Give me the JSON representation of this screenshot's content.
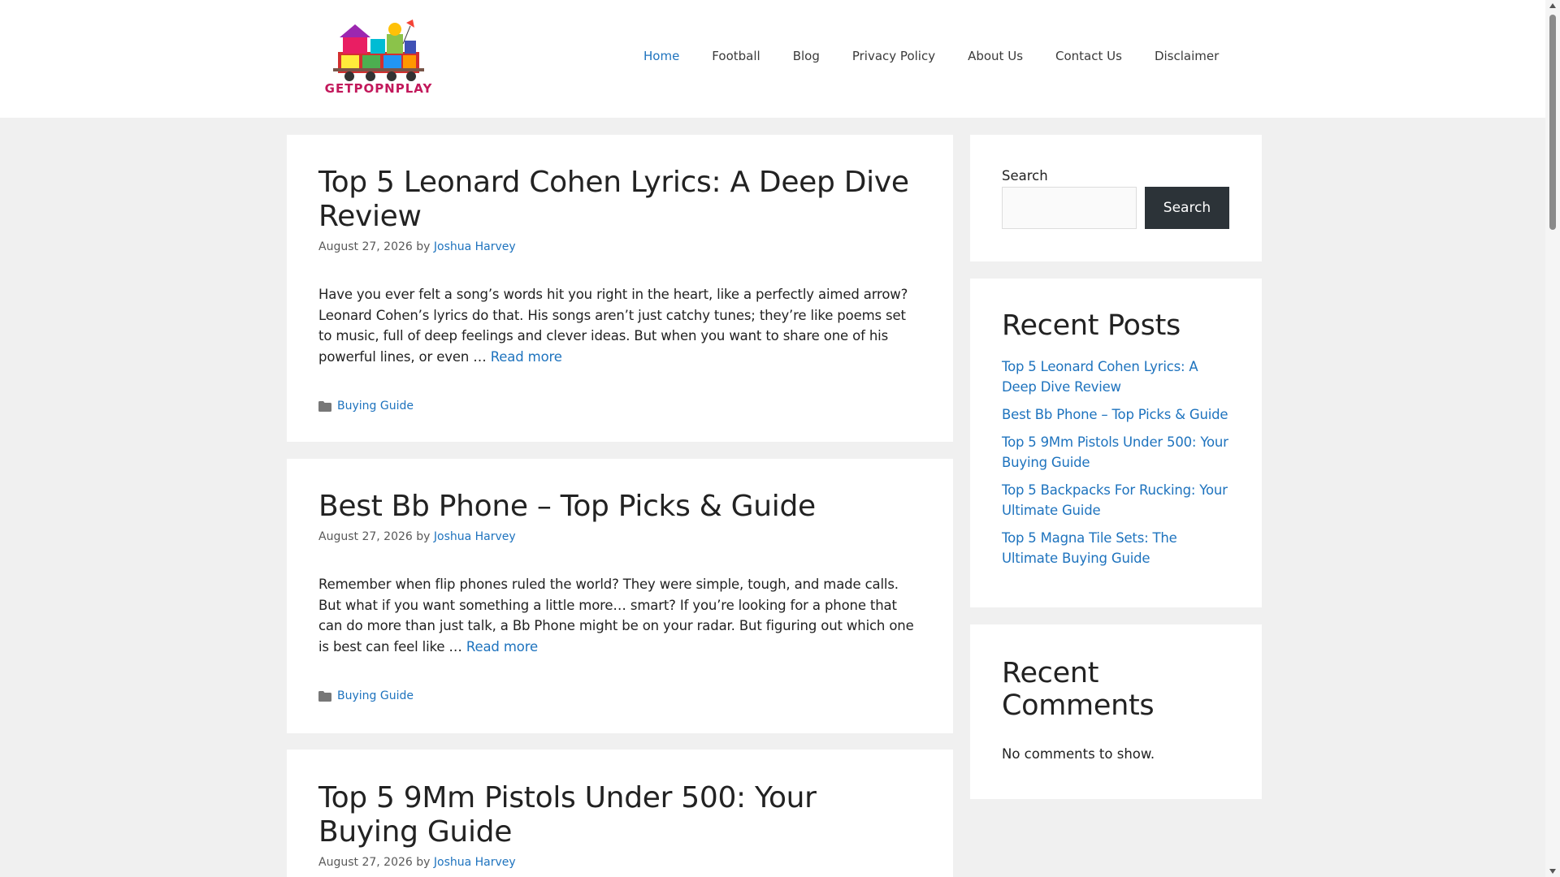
{
  "header": {
    "logo_text": "GETPOPNPLAY",
    "nav": [
      {
        "label": "Home",
        "active": true
      },
      {
        "label": "Football"
      },
      {
        "label": "Blog"
      },
      {
        "label": "Privacy Policy"
      },
      {
        "label": "About Us"
      },
      {
        "label": "Contact Us"
      },
      {
        "label": "Disclaimer"
      }
    ]
  },
  "posts": [
    {
      "title": "Top 5 Leonard Cohen Lyrics: A Deep Dive Review",
      "date": "August 27, 2026",
      "by": "by",
      "author": "Joshua Harvey",
      "excerpt": "Have you ever felt a song’s words hit you right in the heart, like a perfectly aimed arrow? Leonard Cohen’s lyrics do that. His songs aren’t just catchy tunes; they’re like poems set to music, full of deep feelings and clever ideas. But when you want to share one of his powerful lines, or even …",
      "read_more": "Read more",
      "category": "Buying Guide"
    },
    {
      "title": "Best Bb Phone – Top Picks & Guide",
      "date": "August 27, 2026",
      "by": "by",
      "author": "Joshua Harvey",
      "excerpt": "Remember when flip phones ruled the world? They were simple, tough, and made calls. But what if you want something a little more… smart? If you’re looking for a phone that can do more than just talk, a Bb Phone might be on your radar. But figuring out which one is best can feel like …",
      "read_more": "Read more",
      "category": "Buying Guide"
    },
    {
      "title": "Top 5 9Mm Pistols Under 500: Your Buying Guide",
      "date": "August 27, 2026",
      "by": "by",
      "author": "Joshua Harvey"
    }
  ],
  "sidebar": {
    "search": {
      "label": "Search",
      "placeholder": "",
      "button": "Search"
    },
    "recent_posts": {
      "title": "Recent Posts",
      "items": [
        "Top 5 Leonard Cohen Lyrics: A Deep Dive Review",
        "Best Bb Phone – Top Picks & Guide",
        "Top 5 9Mm Pistols Under 500: Your Buying Guide",
        "Top 5 Backpacks For Rucking: Your Ultimate Guide",
        "Top 5 Magna Tile Sets: The Ultimate Buying Guide"
      ]
    },
    "recent_comments": {
      "title": "Recent Comments",
      "empty": "No comments to show."
    }
  },
  "colors": {
    "accent_link": "#1e73be",
    "page_bg": "#f0f0f0",
    "search_button_bg": "#2c3338"
  }
}
